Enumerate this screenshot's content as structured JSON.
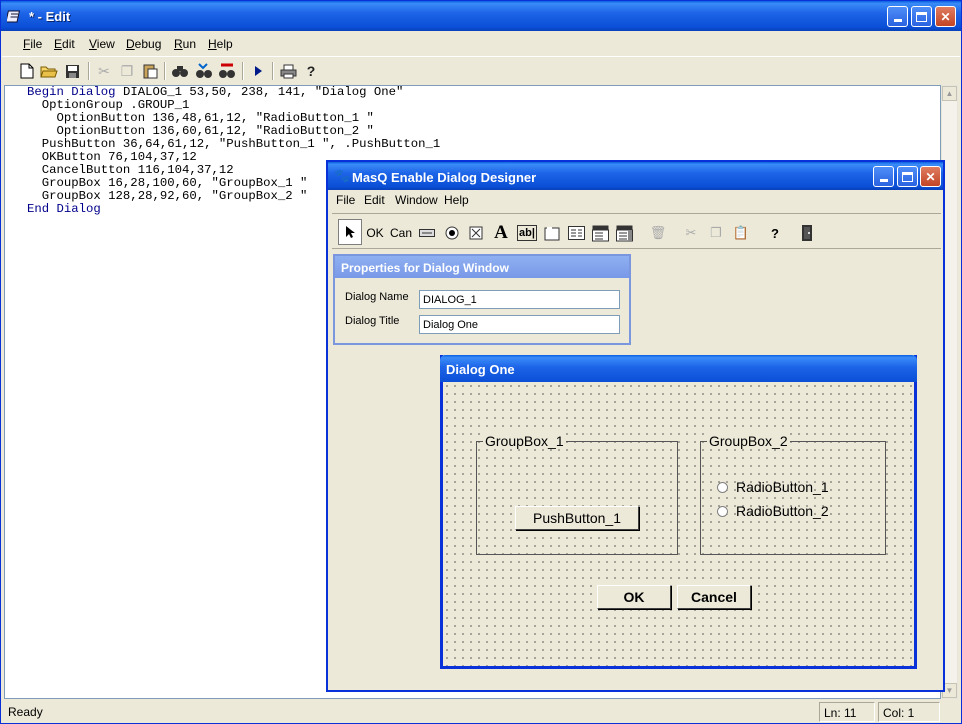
{
  "main_window": {
    "title": "* - Edit",
    "menu": [
      "File",
      "Edit",
      "View",
      "Debug",
      "Run",
      "Help"
    ],
    "menu_underline": [
      "F",
      "E",
      "V",
      "D",
      "R",
      "H"
    ],
    "toolbar_icons": [
      "new-file-icon",
      "open-folder-icon",
      "save-icon",
      "cut-icon",
      "copy-icon",
      "paste-icon",
      "find-icon",
      "find-next-icon",
      "replace-icon",
      "run-icon",
      "print-icon",
      "help-icon"
    ]
  },
  "code_lines": [
    {
      "kw": "Begin Dialog",
      "text": " DIALOG_1 53,50, 238, 141, \"Dialog One\""
    },
    {
      "kw": "",
      "text": "  OptionGroup .GROUP_1"
    },
    {
      "kw": "",
      "text": "    OptionButton 136,48,61,12, \"RadioButton_1 \""
    },
    {
      "kw": "",
      "text": "    OptionButton 136,60,61,12, \"RadioButton_2 \""
    },
    {
      "kw": "",
      "text": "  PushButton 36,64,61,12, \"PushButton_1 \", .PushButton_1"
    },
    {
      "kw": "",
      "text": "  OKButton 76,104,37,12"
    },
    {
      "kw": "",
      "text": "  CancelButton 116,104,37,12"
    },
    {
      "kw": "",
      "text": "  GroupBox 16,28,100,60, \"GroupBox_1 \""
    },
    {
      "kw": "",
      "text": "  GroupBox 128,28,92,60, \"GroupBox_2 \""
    },
    {
      "kw": "End Dialog",
      "text": ""
    }
  ],
  "status": {
    "text": "Ready",
    "line": "Ln: 11",
    "col": "Col: 1"
  },
  "designer": {
    "title": "MasQ Enable Dialog Designer",
    "menu": [
      "File",
      "Edit",
      "Window",
      "Help"
    ],
    "tools": {
      "ok": "OK",
      "cancel": "Can",
      "text": "A",
      "edit": "ab|",
      "help": "?"
    },
    "properties": {
      "title": "Properties for Dialog Window",
      "name_label": "Dialog Name",
      "name_value": "DIALOG_1",
      "title_label": "Dialog Title",
      "title_value": "Dialog One"
    },
    "dialog": {
      "title": "Dialog One",
      "groupbox1": "GroupBox_1",
      "groupbox2": "GroupBox_2",
      "pushbutton": "PushButton_1",
      "radio1": "RadioButton_1",
      "radio2": "RadioButton_2",
      "ok": "OK",
      "cancel": "Cancel"
    }
  }
}
